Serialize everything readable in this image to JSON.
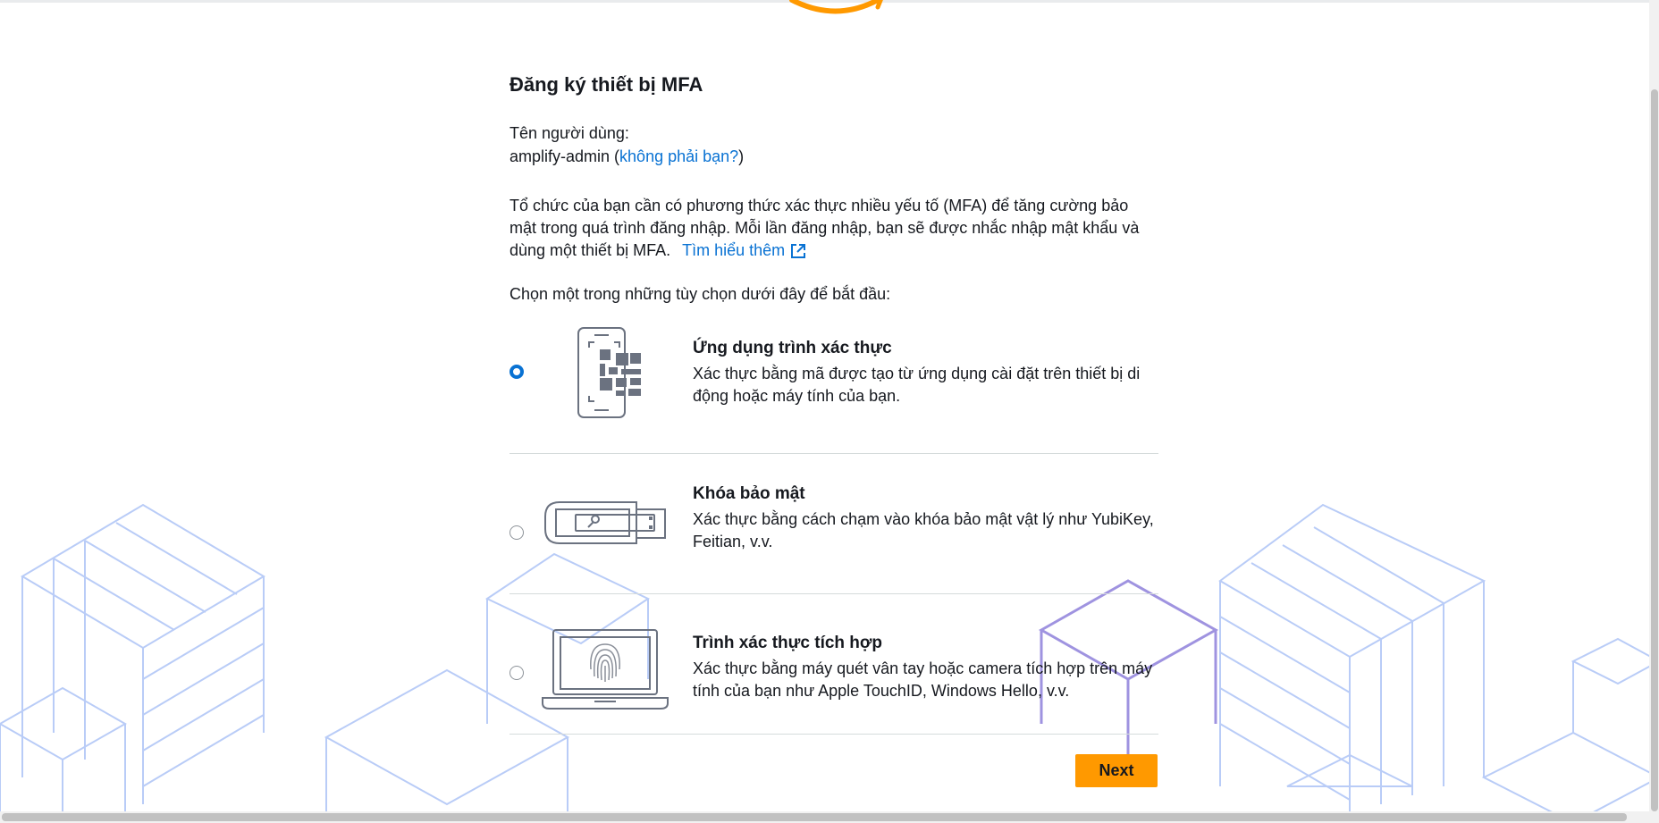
{
  "page": {
    "title": "Đăng ký thiết bị MFA",
    "username_label": "Tên người dùng:",
    "username": "amplify-admin",
    "not_you_link": "không phải bạn?",
    "description": "Tổ chức của bạn cần có phương thức xác thực nhiều yếu tố (MFA) để tăng cường bảo mật trong quá trình đăng nhập. Mỗi lần đăng nhập, bạn sẽ được nhắc nhập mật khẩu và dùng một thiết bị MFA.",
    "learn_more_link": "Tìm hiểu thêm",
    "choose_prompt": "Chọn một trong những tùy chọn dưới đây để bắt đầu:"
  },
  "options": [
    {
      "title": "Ứng dụng trình xác thực",
      "description": "Xác thực bằng mã được tạo từ ứng dụng cài đặt trên thiết bị di động hoặc máy tính của bạn.",
      "selected": true,
      "icon": "phone-qr-icon"
    },
    {
      "title": "Khóa bảo mật",
      "description": "Xác thực bằng cách chạm vào khóa bảo mật vật lý như YubiKey, Feitian, v.v.",
      "selected": false,
      "icon": "usb-key-icon"
    },
    {
      "title": "Trình xác thực tích hợp",
      "description": "Xác thực bằng máy quét vân tay hoặc camera tích hợp trên máy tính của bạn như Apple TouchID, Windows Hello, v.v.",
      "selected": false,
      "icon": "laptop-fingerprint-icon"
    }
  ],
  "actions": {
    "next_label": "Next"
  },
  "colors": {
    "accent_link": "#0972d3",
    "primary_button": "#ff9900",
    "logo_orange": "#ff9900",
    "background_art_blue": "#b9ccf7",
    "background_art_purple": "#9f93e0"
  }
}
